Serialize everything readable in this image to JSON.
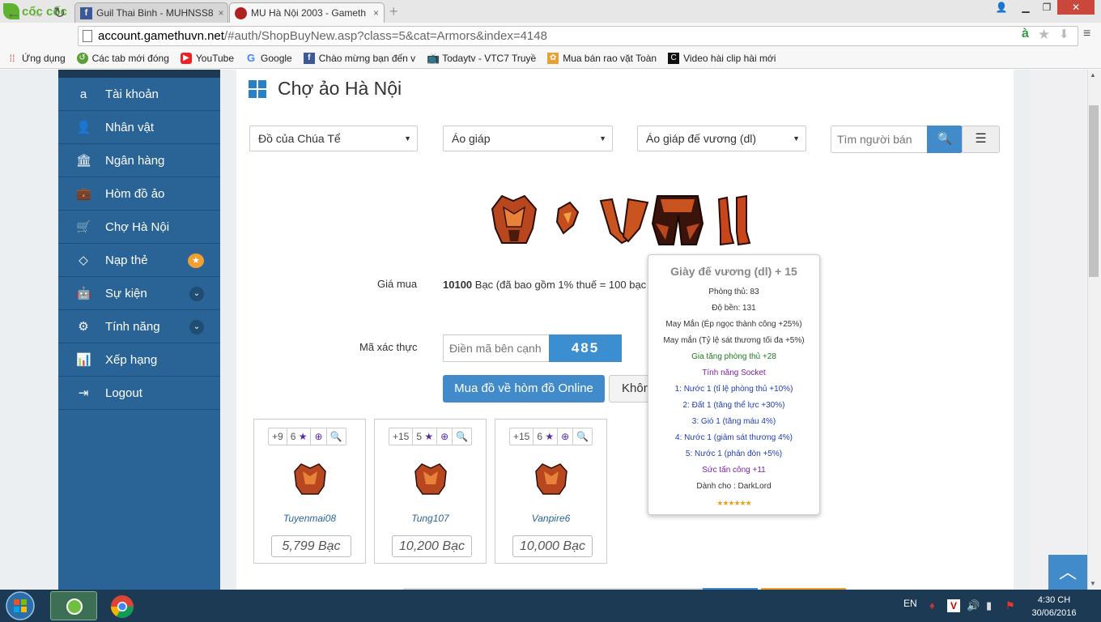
{
  "browser": {
    "logo": "cốc cốc",
    "tabs": [
      {
        "label": "Guil Thai Binh - MUHNSS8"
      },
      {
        "label": "MU Hà Nội 2003 - Gameth"
      }
    ],
    "close": "×",
    "new_tab": "+",
    "url_host": "account.gamethuvn.net",
    "url_path": "/#auth/ShopBuyNew.asp?class=5&cat=Armors&index=4148",
    "bookmarks": [
      {
        "label": "Ứng dụng",
        "icon": "apps-icon"
      },
      {
        "label": "Các tab mới đóng",
        "icon": "recent-tabs-icon"
      },
      {
        "label": "YouTube",
        "icon": "youtube-icon"
      },
      {
        "label": "Google",
        "icon": "google-icon"
      },
      {
        "label": "Chào mừng bạn đến v",
        "icon": "facebook-icon"
      },
      {
        "label": "Todaytv - VTC7 Truyề",
        "icon": "tv-icon"
      },
      {
        "label": "Mua bán rao vặt Toàn",
        "icon": "market-icon"
      },
      {
        "label": "Video hài clip hài mới",
        "icon": "clip-icon"
      }
    ]
  },
  "sidebar": {
    "items": [
      {
        "label": "Tài khoản",
        "icon": "amazon-icon"
      },
      {
        "label": "Nhân vật",
        "icon": "user-icon"
      },
      {
        "label": "Ngân hàng",
        "icon": "bank-icon"
      },
      {
        "label": "Hòm đồ ảo",
        "icon": "briefcase-icon"
      },
      {
        "label": "Chợ Hà Nội",
        "icon": "cart-icon"
      },
      {
        "label": "Nạp thẻ",
        "icon": "diamond-icon"
      },
      {
        "label": "Sự kiện",
        "icon": "android-icon"
      },
      {
        "label": "Tính năng",
        "icon": "gears-icon"
      },
      {
        "label": "Xếp hạng",
        "icon": "bar-chart-icon"
      },
      {
        "label": "Logout",
        "icon": "logout-icon"
      }
    ]
  },
  "main": {
    "title": "Chợ ảo Hà Nội",
    "filters": {
      "category": "Đồ của Chúa Tể",
      "type": "Áo giáp",
      "item": "Áo giáp đế vương (dl)",
      "search_placeholder": "Tìm người bán"
    },
    "price_label": "Giá mua",
    "price_value": "10100",
    "price_note": "Bạc (đã bao gồm 1% thuế = 100 bạc",
    "captcha_label": "Mã xác thực",
    "captcha_placeholder": "Điền mã bên cạnh",
    "captcha_code": "485",
    "buy_button": "Mua đồ về hòm đồ Online",
    "cancel_button": "Không",
    "listings": [
      {
        "plus": "+9",
        "stars": "6",
        "seller": "Tuyenmai08",
        "price": "5,799 Bạc"
      },
      {
        "plus": "+15",
        "stars": "5",
        "seller": "Tung107",
        "price": "10,200 Bạc"
      },
      {
        "plus": "+15",
        "stars": "6",
        "seller": "Vanpire6",
        "price": "10,000 Bạc"
      }
    ]
  },
  "tooltip": {
    "title": "Giày đế vương (dl) + 15",
    "lines": [
      {
        "text": "Phòng thủ: 83",
        "color": "#333333"
      },
      {
        "text": "Độ bền: 131",
        "color": "#333333"
      },
      {
        "text": "May Mắn (Ép ngọc thành công +25%)",
        "color": "#333333"
      },
      {
        "text": "May mắn (Tỷ lệ sát thương tối đa +5%)",
        "color": "#333333"
      },
      {
        "text": "Gia tăng phòng thủ +28",
        "color": "#1f7a1f"
      },
      {
        "text": "Tính năng Socket",
        "color": "#7b1fa2"
      },
      {
        "text": "1: Nước 1 (tỉ lệ phòng thủ +10%)",
        "color": "#1f3fb0"
      },
      {
        "text": "2: Đất 1 (tăng thể lực +30%)",
        "color": "#1f3fb0"
      },
      {
        "text": "3: Gió 1 (tăng máu 4%)",
        "color": "#1f3fb0"
      },
      {
        "text": "4: Nước 1 (giảm sát thương 4%)",
        "color": "#1f3fb0"
      },
      {
        "text": "5: Nước 1 (phản đòn +5%)",
        "color": "#1f3fb0"
      },
      {
        "text": "Sức tấn công +11",
        "color": "#7b1fa2"
      },
      {
        "text": "Dành cho : DarkLord",
        "color": "#333333"
      }
    ],
    "stars": "★★★★★★"
  },
  "taskbar": {
    "lang": "EN",
    "time": "4:30 CH",
    "date": "30/06/2016"
  }
}
